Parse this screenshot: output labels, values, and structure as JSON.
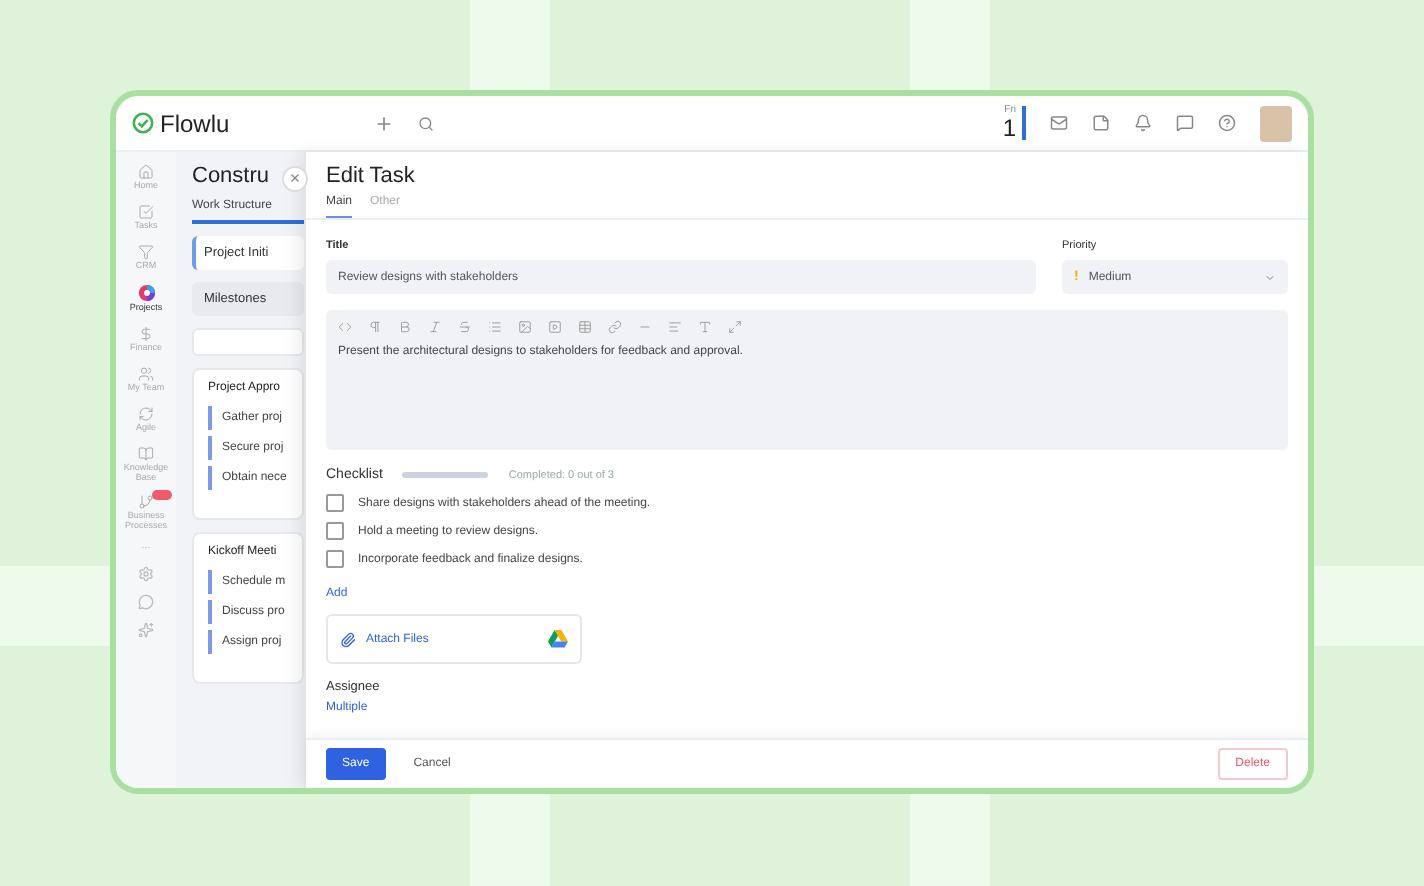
{
  "app": {
    "logo": "Flowlu",
    "date": {
      "weekday": "Fri",
      "day": "1"
    }
  },
  "sidebar": {
    "items": [
      {
        "label": "Home",
        "selected": false,
        "badge": false
      },
      {
        "label": "Tasks",
        "selected": false,
        "badge": false
      },
      {
        "label": "CRM",
        "selected": false,
        "badge": false
      },
      {
        "label": "Projects",
        "selected": true,
        "badge": false
      },
      {
        "label": "Finance",
        "selected": false,
        "badge": false
      },
      {
        "label": "My Team",
        "selected": false,
        "badge": false
      },
      {
        "label": "Agile",
        "selected": false,
        "badge": false
      },
      {
        "label": "Knowledge Base",
        "selected": false,
        "badge": false
      },
      {
        "label": "Business Processes",
        "selected": false,
        "badge": true
      }
    ],
    "more": "···"
  },
  "project": {
    "title": "Constru",
    "tabs": [
      {
        "label": "Work Structure",
        "selected": true
      }
    ],
    "stages": [
      {
        "label": "Project Initi",
        "selected": true
      },
      {
        "label": "Milestones",
        "selected": false
      }
    ],
    "groups": [
      {
        "title": "Project Appro",
        "tasks": [
          "Gather proj",
          "Secure proj",
          "Obtain nece"
        ]
      },
      {
        "title": "Kickoff Meeti",
        "tasks": [
          "Schedule m",
          "Discuss pro",
          "Assign proj"
        ]
      }
    ]
  },
  "edit_task": {
    "title": "Edit Task",
    "close": "×",
    "tabs": [
      {
        "label": "Main",
        "selected": true
      },
      {
        "label": "Other",
        "selected": false
      }
    ],
    "title_field": {
      "label": "Title",
      "value": "Review designs with stakeholders"
    },
    "priority": {
      "label": "Priority",
      "value": "Medium",
      "mark": "!"
    },
    "description": "Present the architectural designs to stakeholders for feedback and approval.",
    "checklist": {
      "label": "Checklist",
      "level": 0,
      "progress": "Completed: 0 out of 3",
      "items": [
        {
          "text": "Share designs with stakeholders ahead of the meeting.",
          "checked": false
        },
        {
          "text": "Hold a meeting to review designs.",
          "checked": false
        },
        {
          "text": "Incorporate feedback and finalize designs.",
          "checked": false
        }
      ],
      "add": "Add"
    },
    "attach": "Attach Files",
    "assignee": {
      "label": "Assignee",
      "value": "Multiple"
    },
    "buttons": {
      "save": "Save",
      "cancel": "Cancel",
      "delete": "Delete"
    }
  }
}
